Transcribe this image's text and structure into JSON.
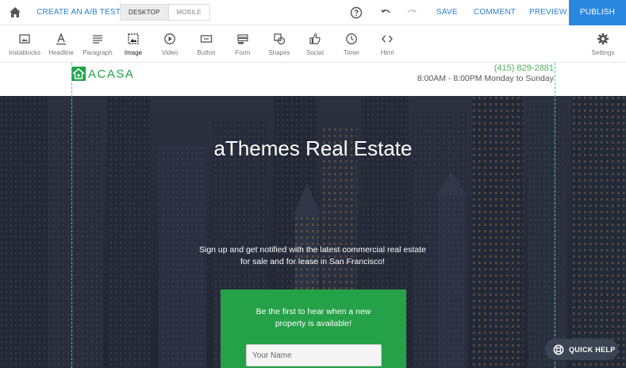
{
  "topbar": {
    "home_icon": "home-icon",
    "ab_test_label": "CREATE AN A/B TEST",
    "device_desktop": "DESKTOP",
    "device_mobile": "MOBILE",
    "help_icon": "help-circle-icon",
    "undo_icon": "undo-icon",
    "redo_icon": "redo-icon",
    "save_label": "SAVE",
    "comment_label": "COMMENT",
    "preview_label": "PREVIEW",
    "publish_label": "PUBLISH",
    "accent_color": "#2a87e0"
  },
  "toolbar": {
    "items": [
      {
        "label": "Instablocks",
        "icon": "instablocks-icon"
      },
      {
        "label": "Headline",
        "icon": "headline-icon"
      },
      {
        "label": "Paragraph",
        "icon": "paragraph-icon"
      },
      {
        "label": "Image",
        "icon": "image-icon"
      },
      {
        "label": "Video",
        "icon": "video-icon"
      },
      {
        "label": "Button",
        "icon": "button-icon"
      },
      {
        "label": "Form",
        "icon": "form-icon"
      },
      {
        "label": "Shapes",
        "icon": "shapes-icon"
      },
      {
        "label": "Social",
        "icon": "social-icon"
      },
      {
        "label": "Timer",
        "icon": "timer-icon"
      },
      {
        "label": "Html",
        "icon": "html-icon"
      }
    ],
    "settings_label": "Settings",
    "settings_icon": "gear-icon"
  },
  "page": {
    "logo_text": "ACASA",
    "phone": "(415) 829-2881",
    "hours": "8:00AM - 8:00PM Monday to Sunday",
    "hero_title": "aThemes Real Estate",
    "hero_subtitle_line1": "Sign up and get notified with the latest commercial real estate",
    "hero_subtitle_line2": "for sale and for lease in San Francisco!",
    "cta_line1": "Be the first to hear when a new",
    "cta_line2": "property is available!",
    "name_placeholder": "Your Name",
    "brand_green": "#25a148"
  },
  "quick_help": {
    "label": "QUICK HELP",
    "icon": "lifebuoy-icon"
  }
}
